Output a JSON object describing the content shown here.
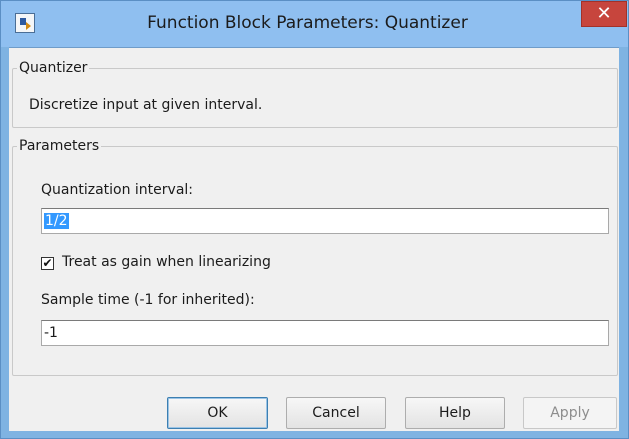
{
  "window": {
    "title": "Function Block Parameters: Quantizer",
    "close_glyph": "✕",
    "app_icon": "simulink-block-icon"
  },
  "block_group": {
    "legend": "Quantizer",
    "description": "Discretize input at given interval."
  },
  "params_group": {
    "legend": "Parameters",
    "quantization_interval": {
      "label": "Quantization interval:",
      "value": "1/2"
    },
    "linearize_checkbox": {
      "label": "Treat as gain when linearizing",
      "checked": true,
      "glyph": "✔"
    },
    "sample_time": {
      "label": "Sample time (-1 for inherited):",
      "value": "-1"
    }
  },
  "buttons": {
    "ok": "OK",
    "cancel": "Cancel",
    "help": "Help",
    "apply": "Apply"
  },
  "colors": {
    "titlebar": "#8fbff0",
    "close_button": "#c7453d",
    "selection": "#3399ff"
  }
}
